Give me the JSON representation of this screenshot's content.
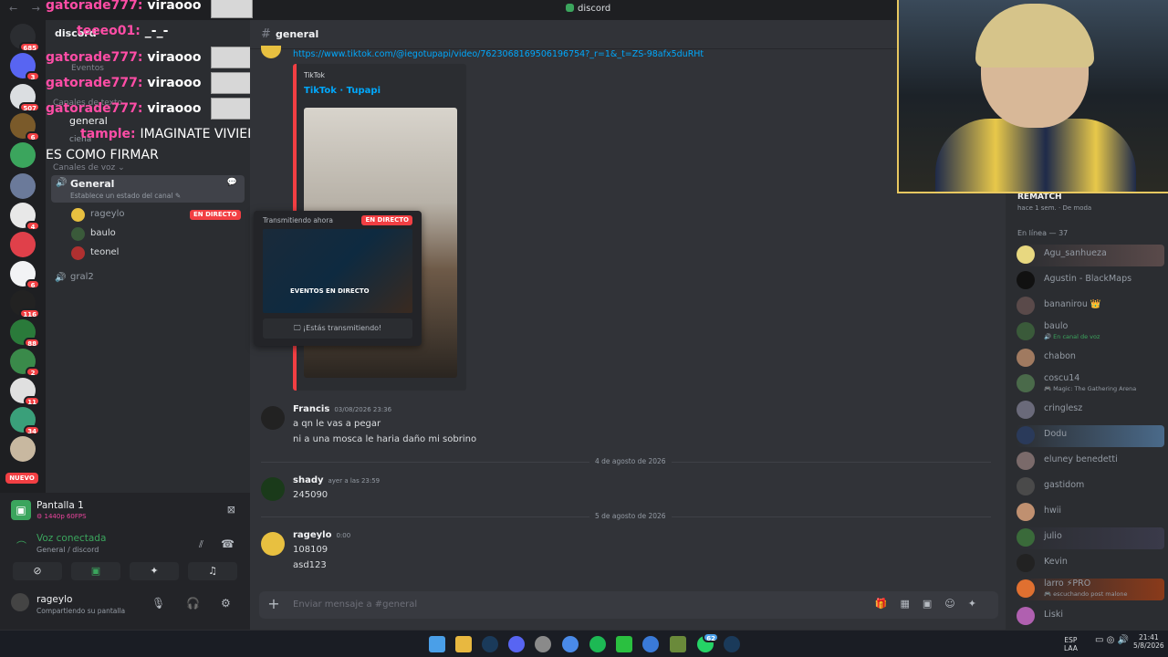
{
  "window": {
    "title": "discord",
    "nav": "← →"
  },
  "servers": {
    "badges": [
      "685",
      "3",
      "507",
      "6",
      "5",
      "",
      "4",
      "",
      "6",
      "116",
      "88",
      "2",
      "11",
      "34",
      ""
    ],
    "new_label": "NUEVO"
  },
  "sidebar": {
    "server_name": "discord",
    "events": "Eventos",
    "text_category": "Canales de texto",
    "text_channels": [
      "general",
      "ciena"
    ],
    "voice_category": "Canales de voz ⌄",
    "voice_channel": {
      "name": "General",
      "status": "Establece un estado del canal ✎"
    },
    "voice_users": [
      {
        "name": "rageylo",
        "live": "EN DIRECTO"
      },
      {
        "name": "baulo"
      },
      {
        "name": "teonel"
      }
    ],
    "other_voice": "gral2"
  },
  "overlay_chat": [
    {
      "user": "gatorade777:",
      "msg": "viraooo"
    },
    {
      "user": "teeeo01:",
      "msg": "_-_-"
    },
    {
      "user": "gatorade777:",
      "msg": "viraooo"
    },
    {
      "user": "gatorade777:",
      "msg": "viraooo"
    },
    {
      "user": "gatorade777:",
      "msg": "viraooo"
    },
    {
      "user": "tample:",
      "msg": "IMAGINATE VIVIERON JUNTOS"
    },
    {
      "user": "",
      "msg": "ES COMO FIRMAR"
    }
  ],
  "panel": {
    "stream_title": "Pantalla 1",
    "stream_quality": "⚙ 1440p 60FPS",
    "voice_status": "Voz conectada",
    "voice_location": "General / discord",
    "username": "rageylo",
    "user_status": "Compartiendo su pantalla"
  },
  "chat": {
    "channel": "general",
    "link": "https://www.tiktok.com/@iegotupapi/video/7623068169506196754?_r=1&_t=ZS-98afx5duRHt",
    "embed_provider": "TikTok",
    "embed_title": "TikTok · Tupapi",
    "stream_popup": {
      "header": "Transmitiendo ahora",
      "live": "EN DIRECTO",
      "preview_label": "EVENTOS EN DIRECTO",
      "footer": "🖵 ¡Estás transmitiendo!"
    },
    "messages": [
      {
        "author": "Francis",
        "time": "03/08/2026 23:36",
        "lines": [
          "a qn le vas a pegar",
          "ni a una mosca le haria daño mi sobrino"
        ]
      },
      {
        "author": "shady",
        "time": "ayer a las 23:59",
        "lines": [
          "245090"
        ]
      },
      {
        "author": "rageylo",
        "time": "0:00",
        "lines": [
          "108109",
          "asd123"
        ]
      }
    ],
    "dividers": [
      "4 de agosto de 2026",
      "5 de agosto de 2026"
    ],
    "composer_placeholder": "Enviar mensaje a #general"
  },
  "members": {
    "activity_title": "REMATCH",
    "activity_sub": "hace 1 sem. · De moda",
    "online_header": "En línea — 37",
    "list": [
      {
        "name": "Agu_sanhueza",
        "sub": ""
      },
      {
        "name": "Agustin - BlackMaps",
        "sub": ""
      },
      {
        "name": "bananirou 👑",
        "sub": ""
      },
      {
        "name": "baulo",
        "sub": "🔊 En canal de voz"
      },
      {
        "name": "chabon",
        "sub": ""
      },
      {
        "name": "coscu14",
        "sub": "🎮 Magic: The Gathering Arena"
      },
      {
        "name": "cringlesz",
        "sub": ""
      },
      {
        "name": "Dodu",
        "sub": ""
      },
      {
        "name": "eluney benedetti",
        "sub": ""
      },
      {
        "name": "gastidom",
        "sub": ""
      },
      {
        "name": "hwii",
        "sub": ""
      },
      {
        "name": "julio",
        "sub": ""
      },
      {
        "name": "Kevin",
        "sub": ""
      },
      {
        "name": "larro ⚡PRO",
        "sub": "🎮 escuchando post malone"
      },
      {
        "name": "Liski",
        "sub": ""
      }
    ]
  },
  "taskbar": {
    "lang": "ESP\nLAA",
    "time": "21:41",
    "date": "5/8/2026",
    "notif_badge": "62"
  }
}
